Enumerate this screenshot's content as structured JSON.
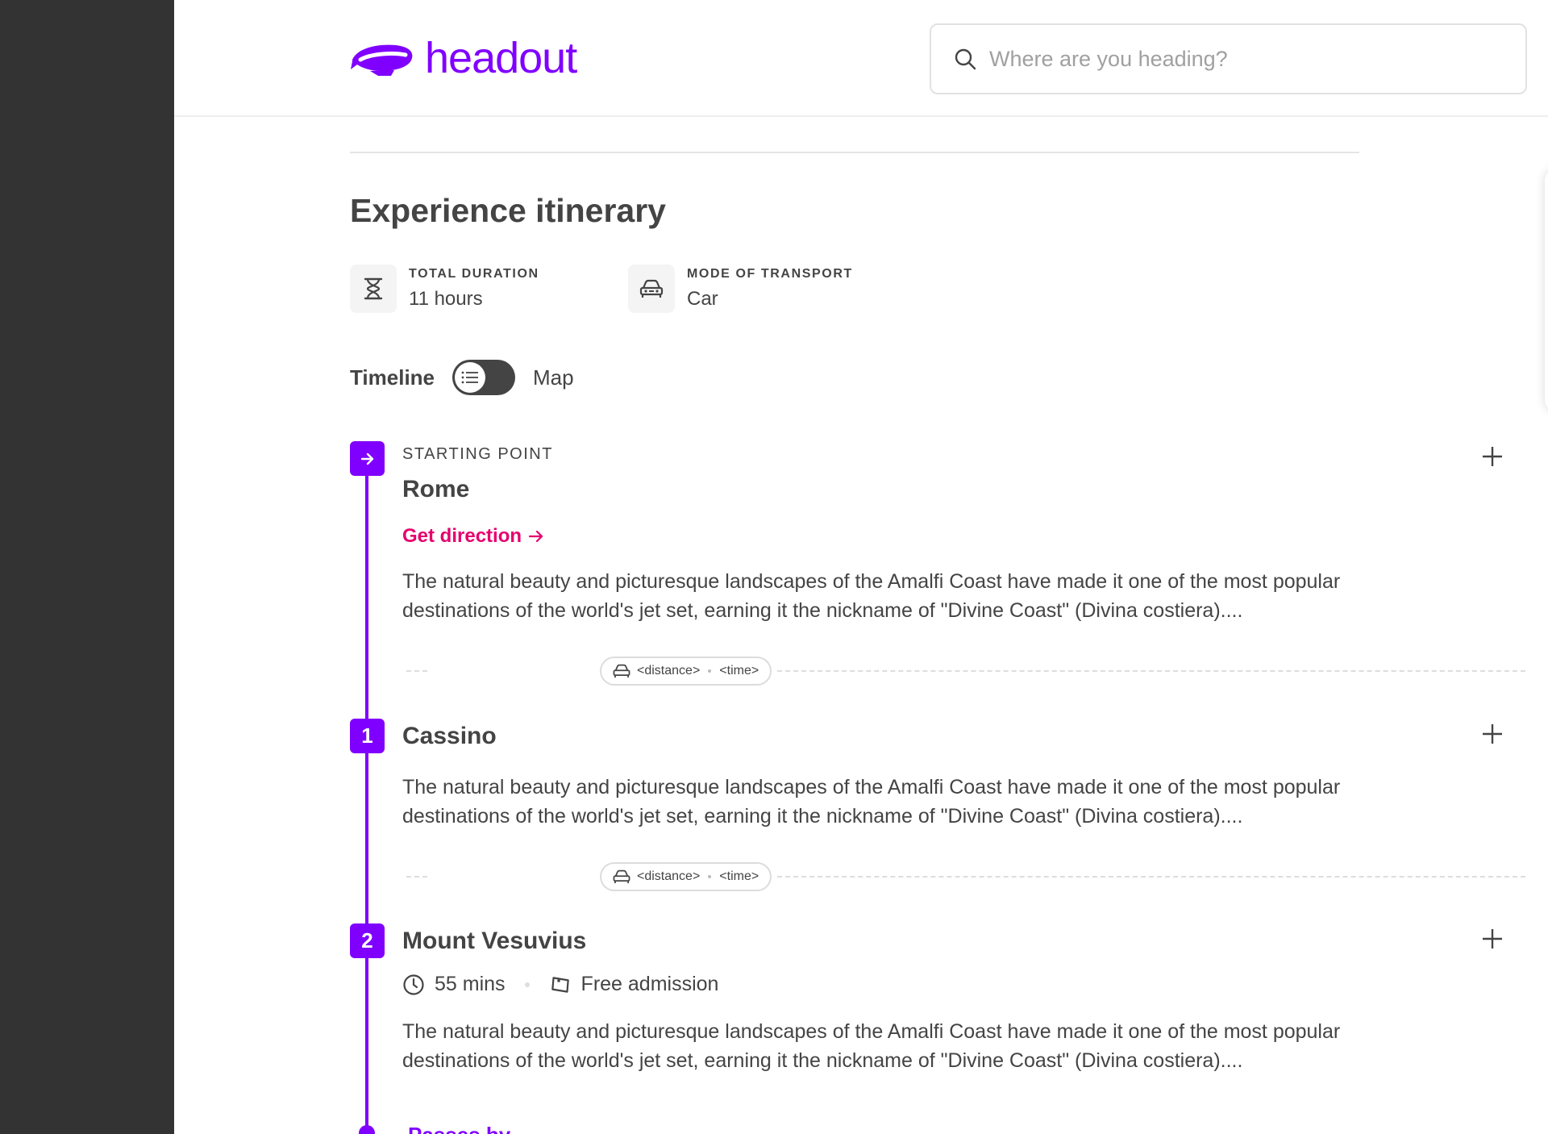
{
  "header": {
    "logo_text": "headout",
    "search_placeholder": "Where are you heading?"
  },
  "itinerary": {
    "title": "Experience itinerary",
    "total_duration": {
      "label": "TOTAL DURATION",
      "value": "11 hours",
      "icon": "hourglass-icon"
    },
    "mode_of_transport": {
      "label": "MODE OF TRANSPORT",
      "value": "Car",
      "icon": "car-icon"
    },
    "view_toggle": {
      "left_label": "Timeline",
      "right_label": "Map",
      "active": "Timeline"
    }
  },
  "stops": [
    {
      "marker": "→",
      "kicker": "STARTING POINT",
      "name": "Rome",
      "link": "Get direction",
      "description": "The natural beauty and picturesque landscapes of the Amalfi Coast have made it one of the most popular destinations of the world's jet set, earning it the nickname of \"Divine Coast\" (Divina costiera)...."
    },
    {
      "marker": "1",
      "name": "Cassino",
      "description": "The natural beauty and picturesque landscapes of the Amalfi Coast have made it one of the most popular destinations of the world's jet set, earning it the nickname of \"Divine Coast\" (Divina costiera)...."
    },
    {
      "marker": "2",
      "name": "Mount Vesuvius",
      "duration": "55 mins",
      "admission": "Free admission",
      "description": "The natural beauty and picturesque landscapes of the Amalfi Coast have made it one of the most popular destinations of the world's jet set, earning it the nickname of \"Divine Coast\" (Divina costiera)...."
    }
  ],
  "transits": [
    {
      "distance": "<distance>",
      "time": "<time>"
    },
    {
      "distance": "<distance>",
      "time": "<time>"
    }
  ],
  "passes_by": "Passes by",
  "colors": {
    "brand": "#8000ff",
    "link": "#e6006e",
    "text": "#444444"
  }
}
